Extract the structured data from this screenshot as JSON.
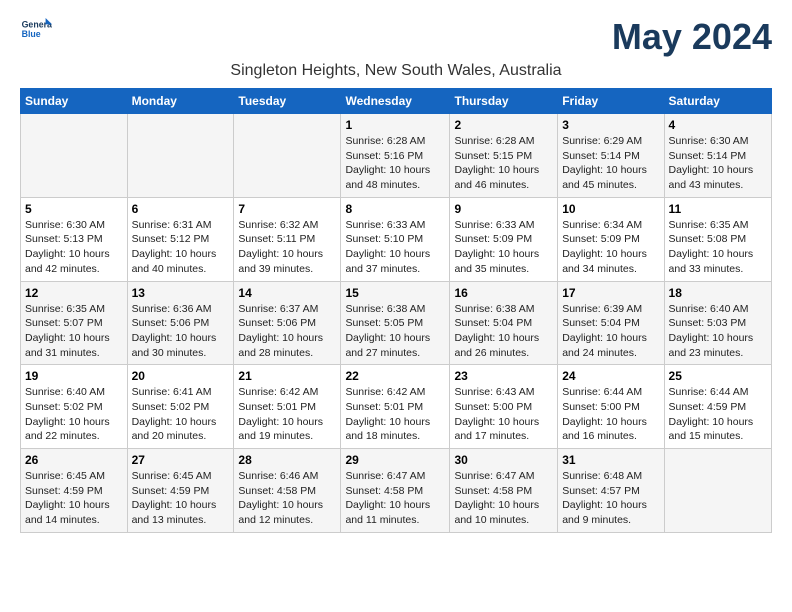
{
  "header": {
    "logo_line1": "General",
    "logo_line2": "Blue",
    "month_title": "May 2024",
    "subtitle": "Singleton Heights, New South Wales, Australia"
  },
  "days_of_week": [
    "Sunday",
    "Monday",
    "Tuesday",
    "Wednesday",
    "Thursday",
    "Friday",
    "Saturday"
  ],
  "weeks": [
    [
      {
        "day": "",
        "info": ""
      },
      {
        "day": "",
        "info": ""
      },
      {
        "day": "",
        "info": ""
      },
      {
        "day": "1",
        "info": "Sunrise: 6:28 AM\nSunset: 5:16 PM\nDaylight: 10 hours\nand 48 minutes."
      },
      {
        "day": "2",
        "info": "Sunrise: 6:28 AM\nSunset: 5:15 PM\nDaylight: 10 hours\nand 46 minutes."
      },
      {
        "day": "3",
        "info": "Sunrise: 6:29 AM\nSunset: 5:14 PM\nDaylight: 10 hours\nand 45 minutes."
      },
      {
        "day": "4",
        "info": "Sunrise: 6:30 AM\nSunset: 5:14 PM\nDaylight: 10 hours\nand 43 minutes."
      }
    ],
    [
      {
        "day": "5",
        "info": "Sunrise: 6:30 AM\nSunset: 5:13 PM\nDaylight: 10 hours\nand 42 minutes."
      },
      {
        "day": "6",
        "info": "Sunrise: 6:31 AM\nSunset: 5:12 PM\nDaylight: 10 hours\nand 40 minutes."
      },
      {
        "day": "7",
        "info": "Sunrise: 6:32 AM\nSunset: 5:11 PM\nDaylight: 10 hours\nand 39 minutes."
      },
      {
        "day": "8",
        "info": "Sunrise: 6:33 AM\nSunset: 5:10 PM\nDaylight: 10 hours\nand 37 minutes."
      },
      {
        "day": "9",
        "info": "Sunrise: 6:33 AM\nSunset: 5:09 PM\nDaylight: 10 hours\nand 35 minutes."
      },
      {
        "day": "10",
        "info": "Sunrise: 6:34 AM\nSunset: 5:09 PM\nDaylight: 10 hours\nand 34 minutes."
      },
      {
        "day": "11",
        "info": "Sunrise: 6:35 AM\nSunset: 5:08 PM\nDaylight: 10 hours\nand 33 minutes."
      }
    ],
    [
      {
        "day": "12",
        "info": "Sunrise: 6:35 AM\nSunset: 5:07 PM\nDaylight: 10 hours\nand 31 minutes."
      },
      {
        "day": "13",
        "info": "Sunrise: 6:36 AM\nSunset: 5:06 PM\nDaylight: 10 hours\nand 30 minutes."
      },
      {
        "day": "14",
        "info": "Sunrise: 6:37 AM\nSunset: 5:06 PM\nDaylight: 10 hours\nand 28 minutes."
      },
      {
        "day": "15",
        "info": "Sunrise: 6:38 AM\nSunset: 5:05 PM\nDaylight: 10 hours\nand 27 minutes."
      },
      {
        "day": "16",
        "info": "Sunrise: 6:38 AM\nSunset: 5:04 PM\nDaylight: 10 hours\nand 26 minutes."
      },
      {
        "day": "17",
        "info": "Sunrise: 6:39 AM\nSunset: 5:04 PM\nDaylight: 10 hours\nand 24 minutes."
      },
      {
        "day": "18",
        "info": "Sunrise: 6:40 AM\nSunset: 5:03 PM\nDaylight: 10 hours\nand 23 minutes."
      }
    ],
    [
      {
        "day": "19",
        "info": "Sunrise: 6:40 AM\nSunset: 5:02 PM\nDaylight: 10 hours\nand 22 minutes."
      },
      {
        "day": "20",
        "info": "Sunrise: 6:41 AM\nSunset: 5:02 PM\nDaylight: 10 hours\nand 20 minutes."
      },
      {
        "day": "21",
        "info": "Sunrise: 6:42 AM\nSunset: 5:01 PM\nDaylight: 10 hours\nand 19 minutes."
      },
      {
        "day": "22",
        "info": "Sunrise: 6:42 AM\nSunset: 5:01 PM\nDaylight: 10 hours\nand 18 minutes."
      },
      {
        "day": "23",
        "info": "Sunrise: 6:43 AM\nSunset: 5:00 PM\nDaylight: 10 hours\nand 17 minutes."
      },
      {
        "day": "24",
        "info": "Sunrise: 6:44 AM\nSunset: 5:00 PM\nDaylight: 10 hours\nand 16 minutes."
      },
      {
        "day": "25",
        "info": "Sunrise: 6:44 AM\nSunset: 4:59 PM\nDaylight: 10 hours\nand 15 minutes."
      }
    ],
    [
      {
        "day": "26",
        "info": "Sunrise: 6:45 AM\nSunset: 4:59 PM\nDaylight: 10 hours\nand 14 minutes."
      },
      {
        "day": "27",
        "info": "Sunrise: 6:45 AM\nSunset: 4:59 PM\nDaylight: 10 hours\nand 13 minutes."
      },
      {
        "day": "28",
        "info": "Sunrise: 6:46 AM\nSunset: 4:58 PM\nDaylight: 10 hours\nand 12 minutes."
      },
      {
        "day": "29",
        "info": "Sunrise: 6:47 AM\nSunset: 4:58 PM\nDaylight: 10 hours\nand 11 minutes."
      },
      {
        "day": "30",
        "info": "Sunrise: 6:47 AM\nSunset: 4:58 PM\nDaylight: 10 hours\nand 10 minutes."
      },
      {
        "day": "31",
        "info": "Sunrise: 6:48 AM\nSunset: 4:57 PM\nDaylight: 10 hours\nand 9 minutes."
      },
      {
        "day": "",
        "info": ""
      }
    ]
  ]
}
